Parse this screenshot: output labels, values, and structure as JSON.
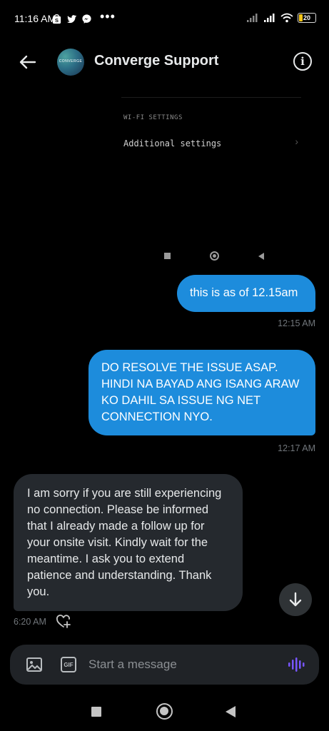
{
  "status_bar": {
    "time": "11:16 AM",
    "left_icons": [
      "shopee-icon",
      "shopee-icon",
      "twitter-icon",
      "messenger-icon"
    ],
    "overflow": "•••",
    "battery": "20"
  },
  "header": {
    "title": "Converge Support",
    "avatar_text": "CONVERGE"
  },
  "shared_image": {
    "section_label": "WI-FI SETTINGS",
    "row_label": "Additional settings"
  },
  "messages": [
    {
      "direction": "out",
      "text": "this is as of 12.15am",
      "time": "12:15 AM"
    },
    {
      "direction": "out",
      "text": "DO RESOLVE THE ISSUE ASAP. HINDI NA BAYAD ANG ISANG ARAW KO DAHIL SA ISSUE NG NET CONNECTION NYO.",
      "time": "12:17 AM"
    },
    {
      "direction": "in",
      "text": "I am sorry if you are still experiencing no connection. Please be informed that I already made a follow up for your onsite visit. Kindly wait for the meantime. I ask you to extend patience and understanding. Thank you.",
      "time": "6:20 AM"
    }
  ],
  "composer": {
    "placeholder": "Start a message",
    "gif_label": "GIF"
  },
  "colors": {
    "background": "#000000",
    "outgoing_bubble": "#1d8cdc",
    "incoming_bubble": "#25292e",
    "voice_accent": "#7856ff"
  }
}
